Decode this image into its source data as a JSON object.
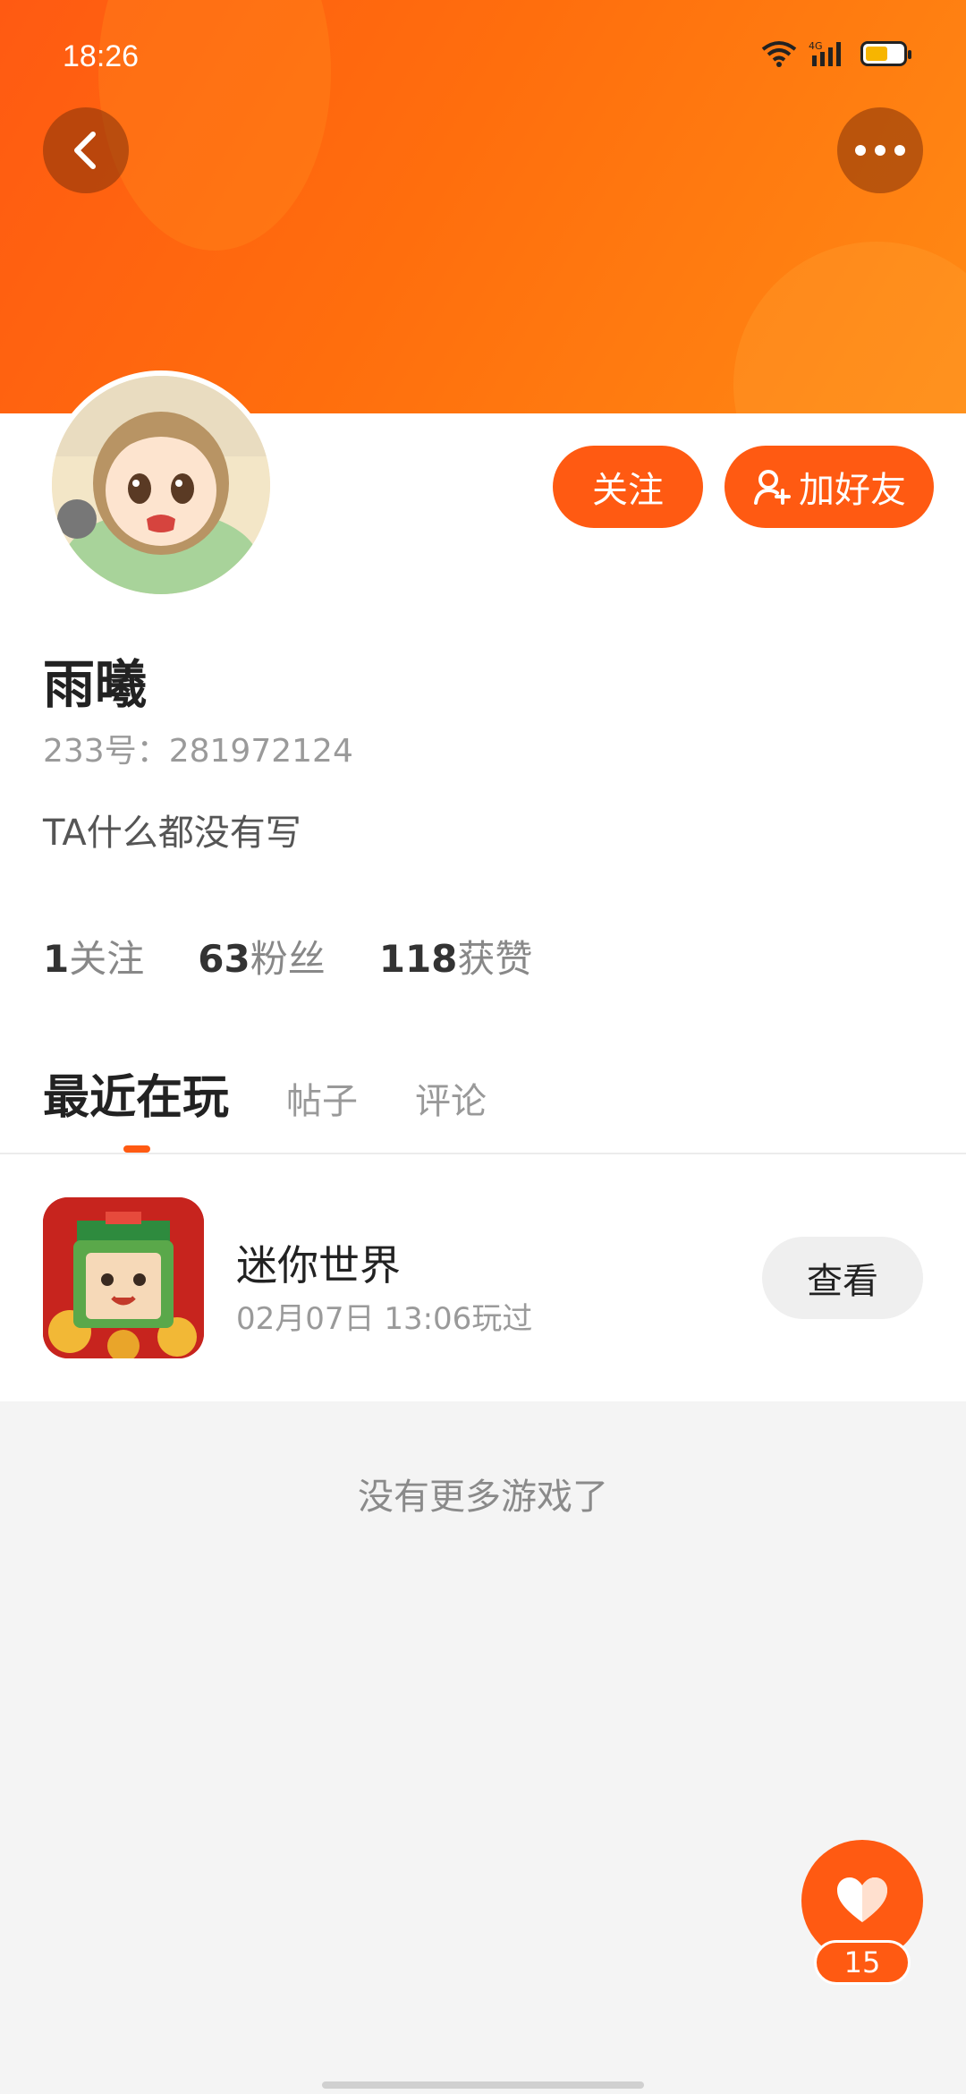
{
  "status": {
    "time": "18:26"
  },
  "header": {
    "back_icon": "chevron-left-icon",
    "more_icon": "more-dots-icon"
  },
  "profile": {
    "follow_label": "关注",
    "add_friend_label": "加好友",
    "username": "雨曦",
    "user_id": "233号：281972124",
    "bio": "TA什么都没有写",
    "stats": [
      {
        "num": "1",
        "label": "关注"
      },
      {
        "num": "63",
        "label": "粉丝"
      },
      {
        "num": "118",
        "label": "获赞"
      }
    ]
  },
  "tabs": [
    "最近在玩",
    "帖子",
    "评论"
  ],
  "games": [
    {
      "name": "迷你世界",
      "time": "02月07日 13:06玩过",
      "action": "查看"
    }
  ],
  "footer_text": "没有更多游戏了",
  "like": {
    "count": "15"
  },
  "colors": {
    "accent": "#ff5a12"
  }
}
